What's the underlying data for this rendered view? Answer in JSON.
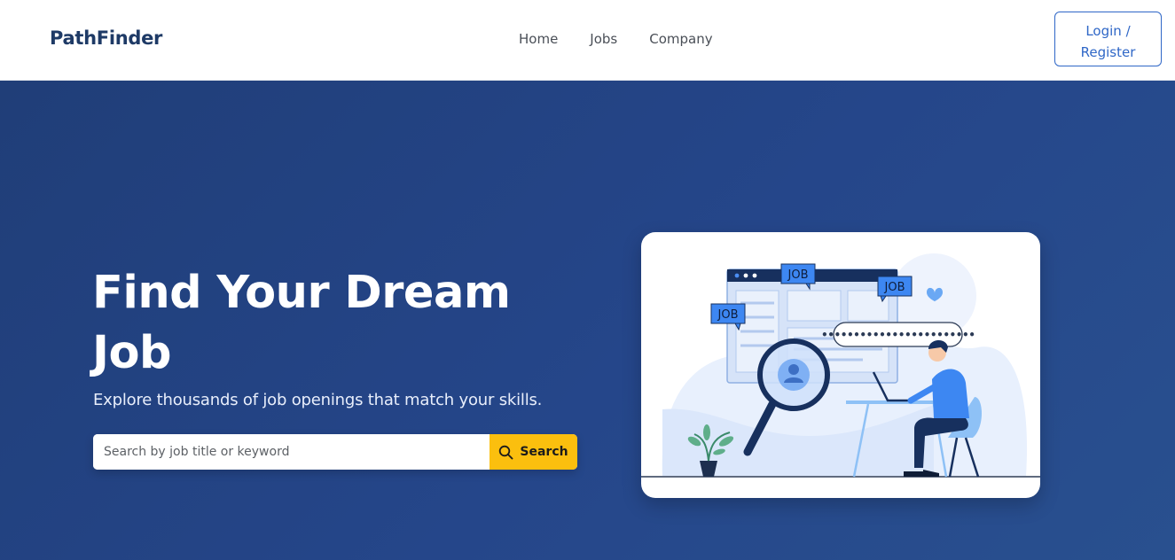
{
  "navbar": {
    "brand": "PathFinder",
    "links": [
      {
        "label": "Home"
      },
      {
        "label": "Jobs"
      },
      {
        "label": "Company"
      }
    ],
    "login_line1": "Login /",
    "login_line2": "Register"
  },
  "hero": {
    "title": "Find Your Dream Job",
    "subtitle": "Explore thousands of job openings that match your skills.",
    "search": {
      "placeholder": "Search by job title or keyword",
      "value": "",
      "button_label": "Search"
    },
    "illustration": {
      "tags": [
        "JOB",
        "JOB",
        "JOB"
      ],
      "icons": [
        "magnifier-icon",
        "heart-icon",
        "plant-icon",
        "user-avatar-icon"
      ]
    }
  },
  "colors": {
    "brand": "#1e3a66",
    "hero_bg": "#23428a",
    "accent_button": "#fbbf0e",
    "link_blue": "#2f67c7"
  }
}
